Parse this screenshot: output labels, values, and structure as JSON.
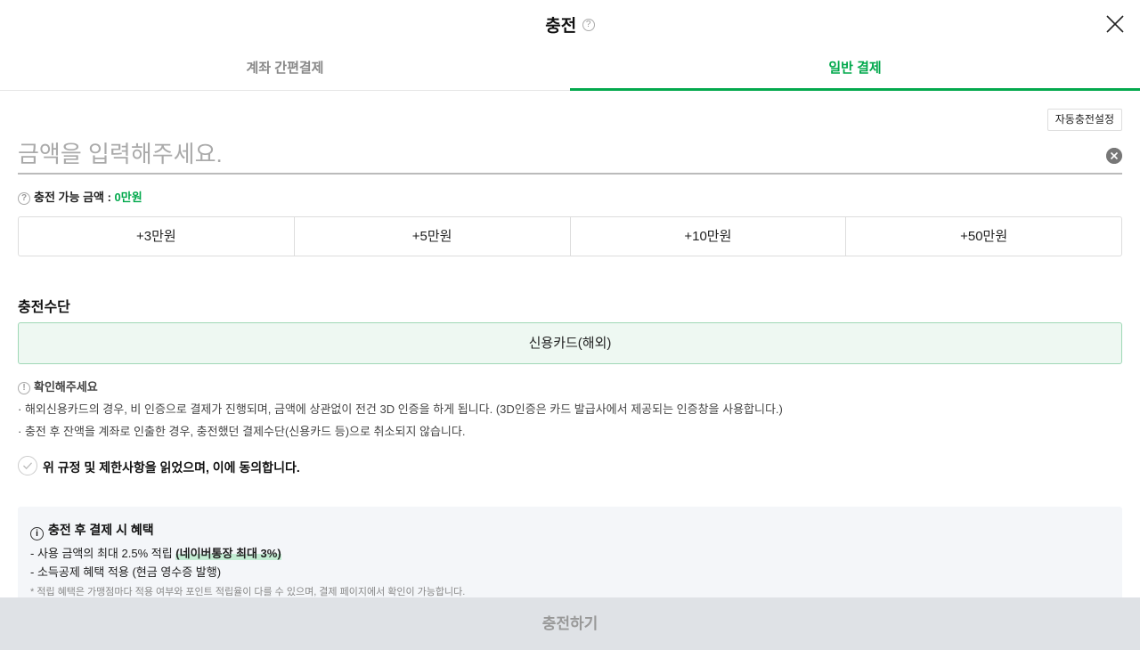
{
  "header": {
    "title": "충전",
    "help_glyph": "?",
    "icons": {
      "help": "question-circle-icon",
      "close": "close-icon"
    }
  },
  "tabs": [
    {
      "label": "계좌 간편결제",
      "active": false
    },
    {
      "label": "일반 결제",
      "active": true
    }
  ],
  "auto_charge_button": "자동충전설정",
  "amount": {
    "value": "",
    "placeholder": "금액을 입력해주세요."
  },
  "limit": {
    "label": "충전 가능 금액 : ",
    "value": "0만원"
  },
  "quick_amounts": [
    "+3만원",
    "+5만원",
    "+10만원",
    "+50만원"
  ],
  "method": {
    "title": "충전수단",
    "selected": "신용카드(해외)"
  },
  "notice": {
    "title": "확인해주세요",
    "lines": [
      "· 해외신용카드의 경우, 비 인증으로 결제가 진행되며, 금액에 상관없이 전건 3D 인증을 하게 됩니다. (3D인증은 카드 발급사에서 제공되는 인증창을 사용합니다.)",
      "· 충전 후 잔액을 계좌로 인출한 경우, 충전했던 결제수단(신용카드 등)으로 취소되지 않습니다."
    ]
  },
  "agreement": {
    "label": "위 규정 및 제한사항을 읽었으며, 이에 동의합니다.",
    "checked": false
  },
  "benefit": {
    "title": "충전 후 결제 시 혜택",
    "info_glyph": "i",
    "line1_prefix": "- 사용 금액의 최대 2.5% 적립 ",
    "line1_highlight": "(네이버통장 최대 3%)",
    "line2": "- 소득공제 혜택 적용 (현금 영수증 발행)",
    "note": "* 적립 혜택은 가맹점마다 적용 여부와 포인트 적립율이 다를 수 있으며, 결제 페이지에서 확인이 가능합니다."
  },
  "submit_button": "충전하기",
  "colors": {
    "accent": "#03a94d",
    "method_bg": "#eef8f2",
    "submit_bg": "#dfe2e6"
  }
}
